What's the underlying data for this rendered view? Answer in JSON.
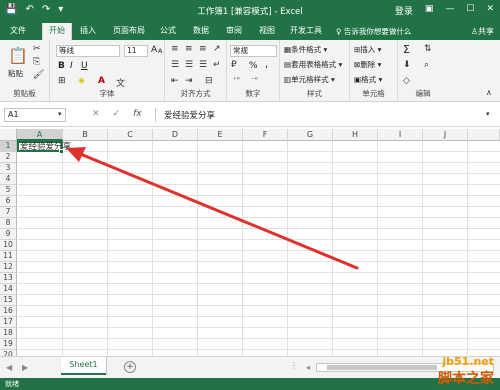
{
  "titlebar": {
    "title": "工作簿1 [兼容模式] - Excel",
    "login": "登录"
  },
  "tabs": [
    "文件",
    "开始",
    "插入",
    "页面布局",
    "公式",
    "数据",
    "审阅",
    "视图",
    "开发工具"
  ],
  "active_tab": "开始",
  "tell_me": "告诉我你想要做什么",
  "share": "共享",
  "ribbon": {
    "clipboard": {
      "paste": "粘贴",
      "label": "剪贴板"
    },
    "font": {
      "name": "等线",
      "size": "11",
      "bold": "B",
      "italic": "I",
      "underline": "U",
      "grow": "A",
      "shrink": "A",
      "label": "字体"
    },
    "alignment": {
      "label": "对齐方式"
    },
    "number": {
      "format": "常规",
      "percent": "%",
      "comma": ",",
      "label": "数字"
    },
    "styles": {
      "conditional": "条件格式",
      "table": "套用表格格式",
      "cell": "单元格样式",
      "label": "样式"
    },
    "cells": {
      "insert": "插入",
      "delete": "删除",
      "format": "格式",
      "label": "单元格"
    },
    "editing": {
      "sum": "Σ",
      "label": "编辑"
    }
  },
  "formula_bar": {
    "name_box": "A1",
    "fx": "fx",
    "content": "爱经验爱分享"
  },
  "sheet": {
    "columns": [
      "A",
      "B",
      "C",
      "D",
      "E",
      "F",
      "G",
      "H",
      "I",
      "J"
    ],
    "rows": [
      "1",
      "2",
      "3",
      "4",
      "5",
      "6",
      "7",
      "8",
      "9",
      "10",
      "11",
      "12",
      "13",
      "14",
      "15",
      "16",
      "17",
      "18",
      "19",
      "20"
    ],
    "a1_value": "爱经验爱分享"
  },
  "sheet_tabs": {
    "active": "Sheet1",
    "add": "+"
  },
  "status": "就绪",
  "watermark": {
    "line1": "jb51.net",
    "line2": "脚本之家"
  },
  "colors": {
    "accent": "#217346",
    "arrow": "#e0322d"
  }
}
